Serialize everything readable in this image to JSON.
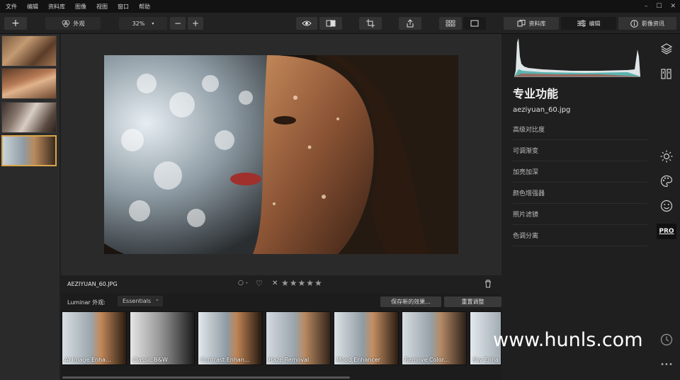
{
  "menu": {
    "items": [
      "文件",
      "编辑",
      "资料库",
      "图像",
      "视图",
      "窗口",
      "帮助"
    ]
  },
  "toolbar": {
    "add": "+",
    "looks_label": "外观",
    "zoom": "32%",
    "minus": "−",
    "plus": "+",
    "library_tab": "资料库",
    "edit_tab": "编辑",
    "info_tab": "影像资讯"
  },
  "image": {
    "filename": "AEZIYUAN_60.JPG",
    "rating_stars": "★★★★★",
    "reject": "✕",
    "flag": "○ -",
    "heart": "♡"
  },
  "looks": {
    "label": "Luminar 外观:",
    "category": "Essentials",
    "save_button": "保存新的效果...",
    "reset_button": "重置调整",
    "presets": [
      "AI Image Enha...",
      "Classic B&W",
      "Contrast Enhan...",
      "Haze Removal",
      "Mood Enhancer",
      "Remove Color...",
      "Sky Enha"
    ]
  },
  "panel": {
    "title": "专业功能",
    "filename": "aeziyuan_60.jpg",
    "filters": [
      "高级对比度",
      "可调渐变",
      "加亮加深",
      "颜色增强器",
      "照片滤镜",
      "色调分离"
    ]
  },
  "rail": {
    "pro": "PRO",
    "more": "•••"
  },
  "watermark": "www.hunls.com"
}
